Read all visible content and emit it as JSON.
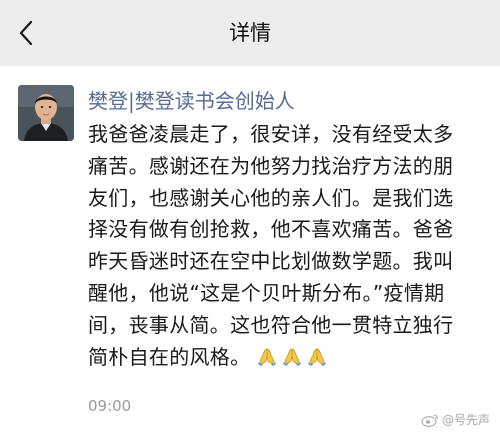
{
  "nav": {
    "title": "详情",
    "back_icon": "chevron-left-icon"
  },
  "post": {
    "author": "樊登|樊登读书会创始人",
    "lines": [
      "我爸爸凌晨走了，很安详，没有经受太多",
      "痛苦。感谢还在为他努力找治疗方法的朋",
      "友们，也感谢关心他的亲人们。是我们选",
      "择没有做有创抢救，他不喜欢痛苦。爸爸",
      "昨天昏迷时还在空中比划做数学题。我叫",
      "醒他，他说“这是个贝叶斯分布。”疫情期",
      "间，丧事从简。这也符合他一贯特立独行",
      "简朴自在的风格。"
    ],
    "emoji": [
      "folded-hands",
      "folded-hands",
      "folded-hands"
    ],
    "time": "09:00"
  },
  "watermark": {
    "text": "@号先声",
    "icon": "weibo-icon"
  },
  "colors": {
    "nav_bg": "#ededed",
    "author": "#576b95",
    "time": "#9b9b9b"
  }
}
